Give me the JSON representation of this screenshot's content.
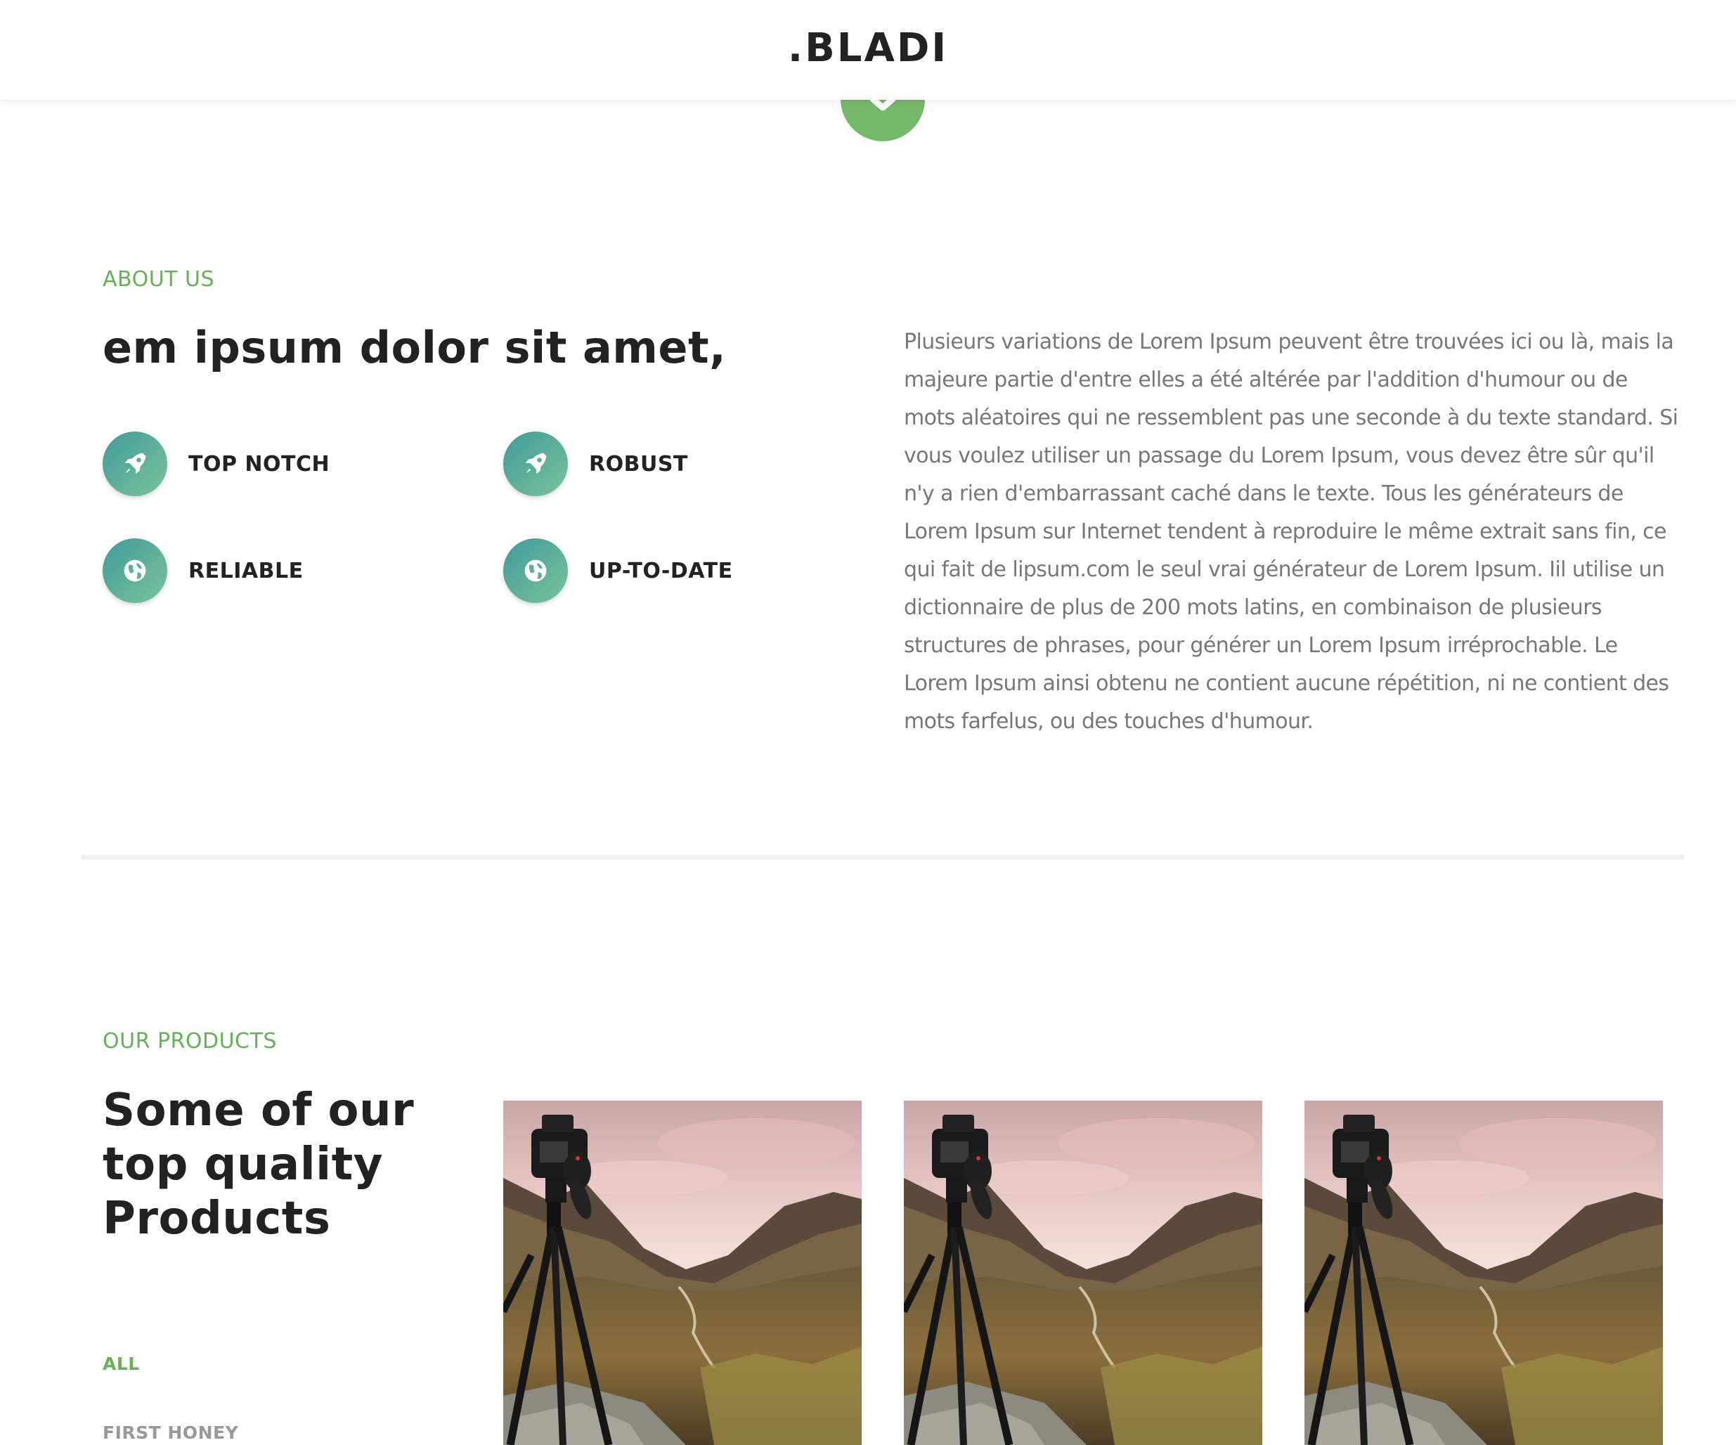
{
  "header": {
    "logo": ".BLADI",
    "scroll_down_icon": "chevron-down-icon"
  },
  "colors": {
    "accent": "#6aaf5c",
    "button_green": "#76b86a",
    "icon_gradient_start": "#3f9a9a",
    "icon_gradient_end": "#7cc39a",
    "heading": "#222222",
    "body_text": "#777777"
  },
  "about": {
    "label": "ABOUT US",
    "title": "em ipsum dolor sit amet,",
    "features": [
      {
        "label": "TOP NOTCH",
        "icon": "rocket-icon"
      },
      {
        "label": "ROBUST",
        "icon": "rocket-icon"
      },
      {
        "label": "RELIABLE",
        "icon": "globe-icon"
      },
      {
        "label": "UP-TO-DATE",
        "icon": "globe-icon"
      }
    ],
    "text": "Plusieurs variations de Lorem Ipsum peuvent être trouvées ici ou là, mais la majeure partie d'entre elles a été altérée par l'addition d'humour ou de mots aléatoires qui ne ressemblent pas une seconde à du texte standard. Si vous voulez utiliser un passage du Lorem Ipsum, vous devez être sûr qu'il n'y a rien d'embarrassant caché dans le texte. Tous les générateurs de Lorem Ipsum sur Internet tendent à reproduire le même extrait sans fin, ce qui fait de lipsum.com le seul vrai générateur de Lorem Ipsum. Iil utilise un dictionnaire de plus de 200 mots latins, en combinaison de plusieurs structures de phrases, pour générer un Lorem Ipsum irréprochable. Le Lorem Ipsum ainsi obtenu ne contient aucune répétition, ni ne contient des mots farfelus, ou des touches d'humour."
  },
  "products": {
    "label": "OUR PRODUCTS",
    "title": "Some of our top quality Products",
    "filters": [
      {
        "label": "ALL",
        "active": true
      },
      {
        "label": "FIRST HONEY",
        "active": false
      }
    ],
    "items": [
      {
        "image": "camera-on-tripod-mountain-landscape-photo"
      },
      {
        "image": "camera-on-tripod-mountain-landscape-photo"
      },
      {
        "image": "camera-on-tripod-mountain-landscape-photo"
      }
    ]
  }
}
